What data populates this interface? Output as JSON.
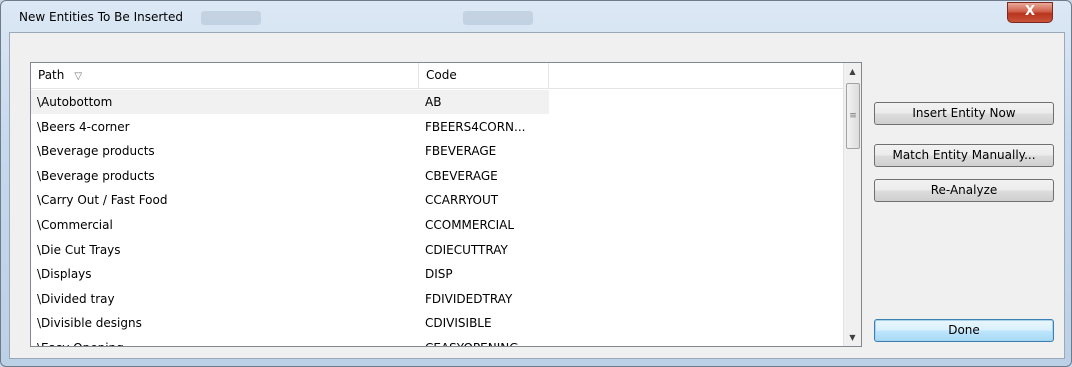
{
  "window": {
    "title": "New Entities To Be Inserted",
    "close_glyph": "X"
  },
  "list": {
    "columns": [
      "Path",
      "Code"
    ],
    "sort_glyph": "▽",
    "rows": [
      {
        "path": "\\Autobottom",
        "code": "AB",
        "selected": true
      },
      {
        "path": "\\Beers 4-corner",
        "code": "FBEERS4CORN...",
        "selected": false
      },
      {
        "path": "\\Beverage products",
        "code": "FBEVERAGE",
        "selected": false
      },
      {
        "path": "\\Beverage products",
        "code": "CBEVERAGE",
        "selected": false
      },
      {
        "path": "\\Carry Out / Fast Food",
        "code": "CCARRYOUT",
        "selected": false
      },
      {
        "path": "\\Commercial",
        "code": "CCOMMERCIAL",
        "selected": false
      },
      {
        "path": "\\Die Cut Trays",
        "code": "CDIECUTTRAY",
        "selected": false
      },
      {
        "path": "\\Displays",
        "code": "DISP",
        "selected": false
      },
      {
        "path": "\\Divided tray",
        "code": "FDIVIDEDTRAY",
        "selected": false
      },
      {
        "path": "\\Divisible designs",
        "code": "CDIVISIBLE",
        "selected": false
      },
      {
        "path": "\\Easy Opening",
        "code": "CEASYOPENING",
        "selected": false
      }
    ]
  },
  "buttons": {
    "insert": "Insert Entity Now",
    "match": "Match Entity Manually...",
    "reanalyze": "Re-Analyze",
    "done": "Done"
  },
  "icons": {
    "scroll_up": "scroll-up-arrow-icon",
    "scroll_down": "scroll-down-arrow-icon",
    "close": "close-icon"
  }
}
